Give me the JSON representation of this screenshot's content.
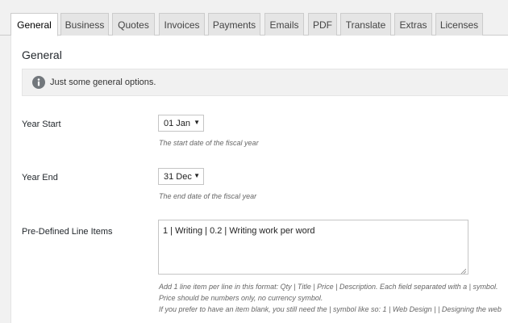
{
  "tabs": [
    {
      "label": "General",
      "active": true
    },
    {
      "label": "Business"
    },
    {
      "label": "Quotes"
    },
    {
      "label": "Invoices"
    },
    {
      "label": "Payments"
    },
    {
      "label": "Emails"
    },
    {
      "label": "PDF"
    },
    {
      "label": "Translate"
    },
    {
      "label": "Extras"
    },
    {
      "label": "Licenses"
    }
  ],
  "panel": {
    "title": "General",
    "notice": "Just some general options.",
    "notice_icon": "info-icon"
  },
  "fields": {
    "year_start": {
      "label": "Year Start",
      "value": "01 Jan",
      "description": "The start date of the fiscal year"
    },
    "year_end": {
      "label": "Year End",
      "value": "31 Dec",
      "description": "The end date of the fiscal year"
    },
    "line_items": {
      "label": "Pre-Defined Line Items",
      "value": "1 | Writing | 0.2 | Writing work per word",
      "description_lines": [
        "Add 1 line item per line in this format: Qty | Title | Price | Description. Each field separated with a | symbol.",
        "Price should be numbers only, no currency symbol.",
        "If you prefer to have an item blank, you still need the | symbol like so: 1 | Web Design | | Designing the web"
      ]
    }
  },
  "colors": {
    "page_bg": "#f1f1f1",
    "tab_bg": "#e5e5e5",
    "panel_bg": "#ffffff",
    "icon": "#72777c"
  }
}
